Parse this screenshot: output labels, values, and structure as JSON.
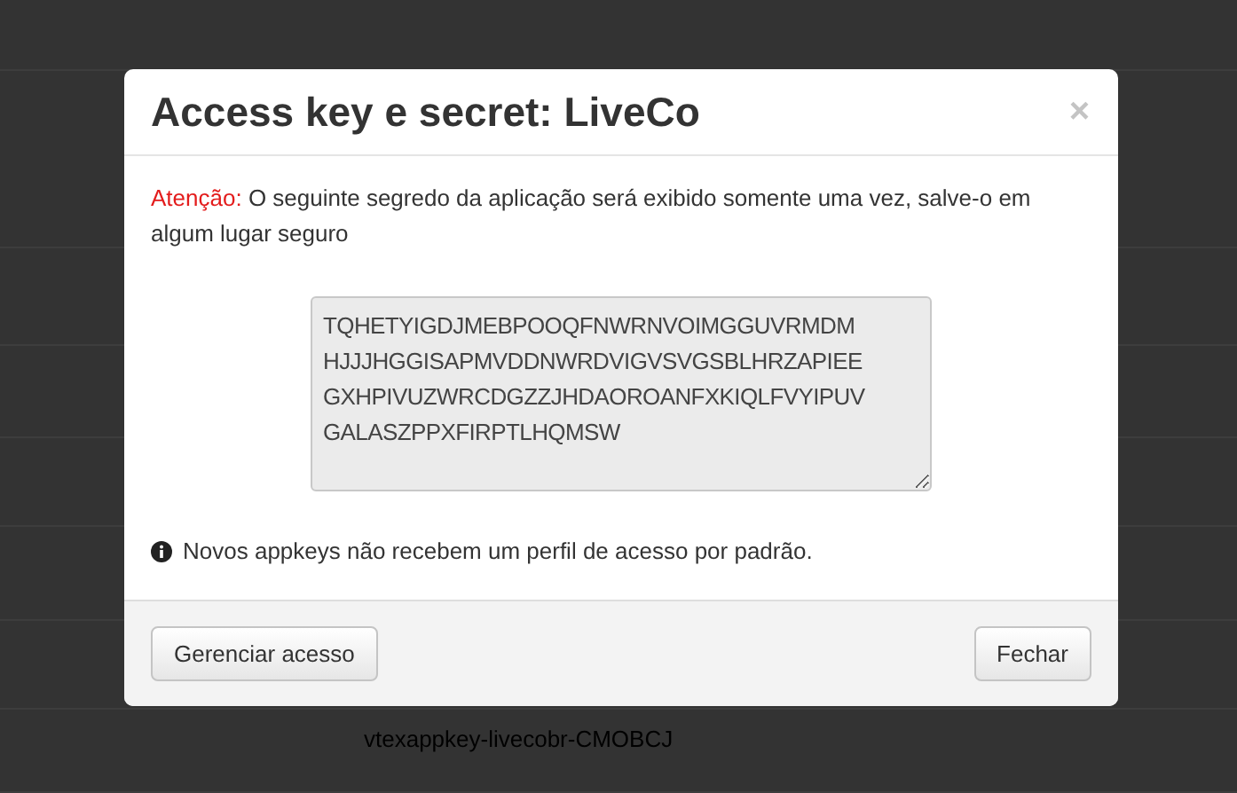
{
  "background": {
    "row_text": "vtexappkey-livecobr-CMOBCJ"
  },
  "modal": {
    "title": "Access key e secret: LiveCo",
    "close": "×",
    "warning_label": "Atenção:",
    "warning_text": "O seguinte segredo da aplicação será exibido somente uma vez, salve-o em algum lugar seguro",
    "secret_lines": [
      "TQHETYIGDJMEBPOOQFNWRNVOIMGGUVRMDM",
      "HJJJHGGISAPMVDDNWRDVIGVSVGSBLHRZAPIEE",
      "GXHPIVUZWRCDGZZJHDAOROANFXKIQLFVYIPUV",
      "GALASZPPXFIRPTLHQMSW"
    ],
    "info_note": "Novos appkeys não recebem um perfil de acesso por padrão.",
    "buttons": [
      {
        "label": "Gerenciar acesso"
      },
      {
        "label": "Fechar"
      }
    ]
  }
}
